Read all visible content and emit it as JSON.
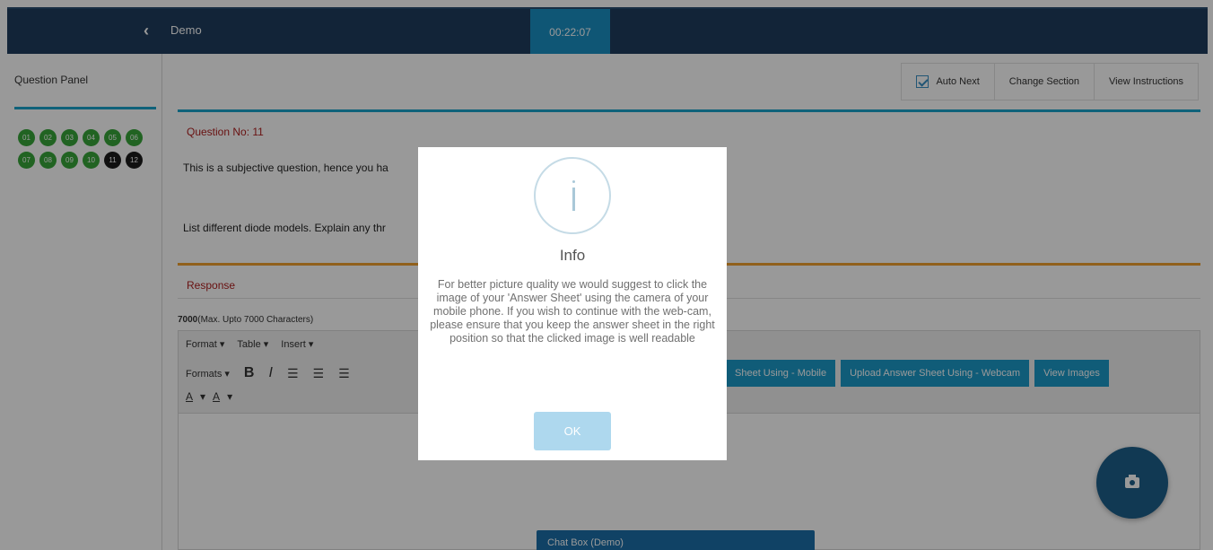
{
  "header": {
    "back_label": "Demo",
    "timer": "00:22:07"
  },
  "sidebar": {
    "title": "Question Panel",
    "questions": [
      {
        "label": "01",
        "status": "answered"
      },
      {
        "label": "02",
        "status": "answered"
      },
      {
        "label": "03",
        "status": "answered"
      },
      {
        "label": "04",
        "status": "answered"
      },
      {
        "label": "05",
        "status": "answered"
      },
      {
        "label": "06",
        "status": "answered"
      },
      {
        "label": "07",
        "status": "answered"
      },
      {
        "label": "08",
        "status": "answered"
      },
      {
        "label": "09",
        "status": "answered"
      },
      {
        "label": "10",
        "status": "answered"
      },
      {
        "label": "11",
        "status": "not-visited"
      },
      {
        "label": "12",
        "status": "not-visited"
      }
    ]
  },
  "toolbar": {
    "auto_next": "Auto Next",
    "change_section": "Change Section",
    "view_instructions": "View Instructions"
  },
  "question": {
    "number": "Question No: 11",
    "note": "This is a subjective question, hence you ha",
    "text": "List different diode models. Explain any thr"
  },
  "response": {
    "label": "Response",
    "char_count": "7000",
    "char_limit": "(Max. Upto 7000 Characters)"
  },
  "editor": {
    "menu": [
      "Format ▾",
      "Table ▾",
      "Insert ▾"
    ],
    "formats": "Formats ▾",
    "bold": "B",
    "italic": "I",
    "align_left": "☰",
    "align_center": "☰",
    "align_right": "☰",
    "font_color": "A",
    "bg_color": "A",
    "upload_mobile": "Sheet Using - Mobile",
    "upload_webcam": "Upload Answer Sheet Using - Webcam",
    "view_images": "View Images"
  },
  "chat": {
    "label": "Chat Box (Demo)"
  },
  "modal": {
    "title": "Info",
    "message": "For better picture quality we would suggest to click the image of your 'Answer Sheet' using the camera of your mobile phone. If you wish to continue with the web-cam, please ensure that you keep the answer sheet in the right position so that the clicked image is well readable",
    "ok_label": "OK"
  },
  "colors": {
    "topbar": "#1e3d5e",
    "timer": "#1a8fc4",
    "answered": "#37a63a",
    "not_visited": "#1b1b1b",
    "accent": "#1b9ac9"
  }
}
